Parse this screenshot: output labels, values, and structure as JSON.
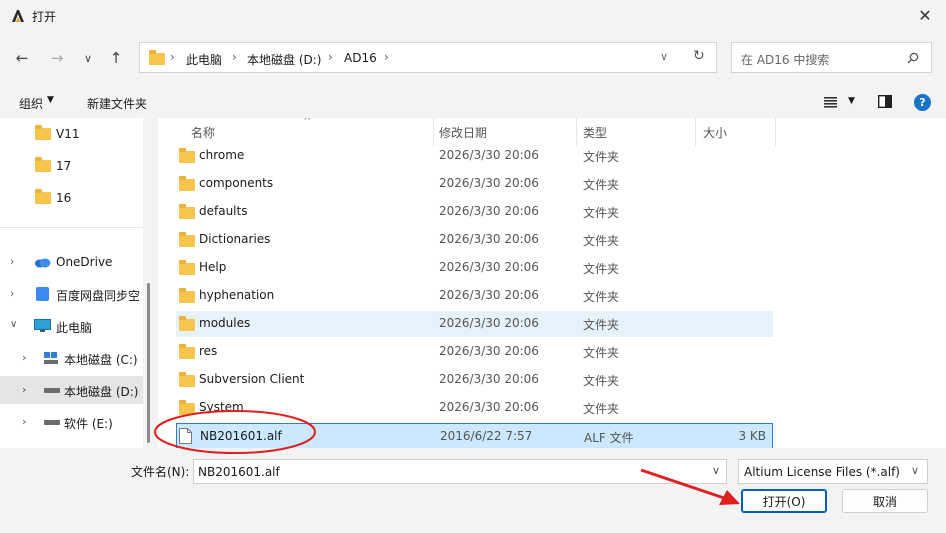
{
  "window": {
    "title": "打开",
    "close_icon": "close-icon"
  },
  "nav": {
    "back_icon": "arrow-left-icon",
    "forward_icon": "arrow-right-icon",
    "recent_icon": "chevron-down-icon",
    "up_icon": "arrow-up-icon",
    "breadcrumb": [
      "此电脑",
      "本地磁盘 (D:)",
      "AD16"
    ],
    "search_placeholder": "在 AD16 中搜索"
  },
  "toolbar": {
    "organize_label": "组织",
    "new_folder_label": "新建文件夹"
  },
  "sidebar": {
    "items": [
      {
        "label": "V11",
        "icon": "folder-icon"
      },
      {
        "label": "17",
        "icon": "folder-icon"
      },
      {
        "label": "16",
        "icon": "folder-icon"
      },
      {
        "label": "OneDrive",
        "icon": "cloud-icon"
      },
      {
        "label": "百度网盘同步空",
        "icon": "baidu-netdisk-icon"
      },
      {
        "label": "此电脑",
        "icon": "computer-icon"
      },
      {
        "label": "本地磁盘 (C:)",
        "icon": "drive-icon"
      },
      {
        "label": "本地磁盘 (D:)",
        "icon": "drive-icon"
      },
      {
        "label": "软件 (E:)",
        "icon": "drive-icon"
      }
    ]
  },
  "list": {
    "columns": {
      "name": "名称",
      "modified": "修改日期",
      "type": "类型",
      "size": "大小"
    },
    "rows": [
      {
        "name": "chrome",
        "modified": "2026/3/30 20:06",
        "type": "文件夹",
        "size": ""
      },
      {
        "name": "components",
        "modified": "2026/3/30 20:06",
        "type": "文件夹",
        "size": ""
      },
      {
        "name": "defaults",
        "modified": "2026/3/30 20:06",
        "type": "文件夹",
        "size": ""
      },
      {
        "name": "Dictionaries",
        "modified": "2026/3/30 20:06",
        "type": "文件夹",
        "size": ""
      },
      {
        "name": "Help",
        "modified": "2026/3/30 20:06",
        "type": "文件夹",
        "size": ""
      },
      {
        "name": "hyphenation",
        "modified": "2026/3/30 20:06",
        "type": "文件夹",
        "size": ""
      },
      {
        "name": "modules",
        "modified": "2026/3/30 20:06",
        "type": "文件夹",
        "size": ""
      },
      {
        "name": "res",
        "modified": "2026/3/30 20:06",
        "type": "文件夹",
        "size": ""
      },
      {
        "name": "Subversion Client",
        "modified": "2026/3/30 20:06",
        "type": "文件夹",
        "size": ""
      },
      {
        "name": "System",
        "modified": "2026/3/30 20:06",
        "type": "文件夹",
        "size": ""
      },
      {
        "name": "NB201601.alf",
        "modified": "2016/6/22 7:57",
        "type": "ALF 文件",
        "size": "3 KB"
      }
    ]
  },
  "footer": {
    "filename_label": "文件名(N):",
    "filename_value": "NB201601.alf",
    "filter_value": "Altium License Files (*.alf)",
    "open_label": "打开(O)",
    "cancel_label": "取消"
  },
  "colors": {
    "accent": "#005fb8",
    "selected_bg": "#cce8ff",
    "annotation": "#e02020"
  }
}
